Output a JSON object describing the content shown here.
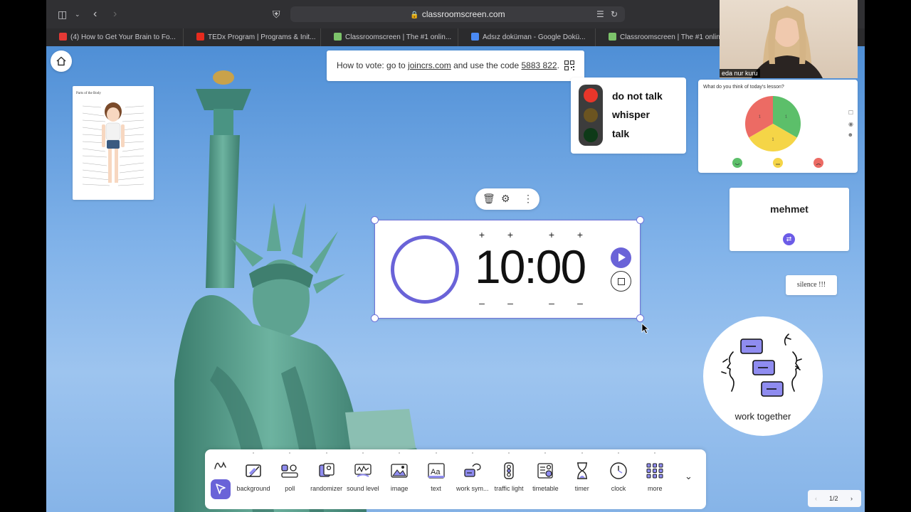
{
  "browser": {
    "url": "classroomscreen.com",
    "tabs": [
      {
        "label": "(4) How to Get Your Brain to Fo...",
        "color": "#e53935"
      },
      {
        "label": "TEDx Program | Programs & Init...",
        "color": "#e62b1e"
      },
      {
        "label": "Classroomscreen | The #1 onlin...",
        "color": "#7cc36a"
      },
      {
        "label": "Adsız doküman - Google Dokü...",
        "color": "#4a8af4"
      },
      {
        "label": "Classroomscreen | The #1 onlin...",
        "color": "#7cc36a"
      }
    ]
  },
  "vote": {
    "prefix": "How to vote: go to ",
    "link": "joincrs.com",
    "middle": " and use the code ",
    "code": "5883 822",
    "suffix": "."
  },
  "worksheet": {
    "title": "Parts of the Body"
  },
  "traffic_light": {
    "labels": [
      "do not talk",
      "whisper",
      "talk"
    ],
    "colors": {
      "red": "#e8362a",
      "yellow": "#6b5420",
      "green": "#0e3a18"
    }
  },
  "poll": {
    "question": "What do you think of today's lesson?",
    "chart_data": {
      "type": "pie",
      "values": [
        1,
        1,
        1
      ],
      "colors": [
        "#5cbf6a",
        "#f5d547",
        "#ec6b64"
      ]
    }
  },
  "random_name": {
    "name": "mehmet"
  },
  "note": {
    "text": "silence !!!"
  },
  "work_symbol": {
    "label": "work together"
  },
  "timer": {
    "value": "10:00"
  },
  "toolbar": {
    "tools": [
      {
        "label": "background",
        "icon": "background-icon"
      },
      {
        "label": "poll",
        "icon": "poll-icon"
      },
      {
        "label": "randomizer",
        "icon": "randomizer-icon"
      },
      {
        "label": "sound level",
        "icon": "sound-level-icon"
      },
      {
        "label": "image",
        "icon": "image-icon"
      },
      {
        "label": "text",
        "icon": "text-icon"
      },
      {
        "label": "work sym...",
        "icon": "work-symbols-icon"
      },
      {
        "label": "traffic light",
        "icon": "traffic-light-icon"
      },
      {
        "label": "timetable",
        "icon": "timetable-icon"
      },
      {
        "label": "timer",
        "icon": "timer-icon"
      },
      {
        "label": "clock",
        "icon": "clock-icon"
      },
      {
        "label": "more",
        "icon": "more-icon"
      }
    ]
  },
  "pager": {
    "text": "1/2"
  },
  "webcam": {
    "name": "eda nur kuru"
  },
  "accent": "#6a63d8"
}
